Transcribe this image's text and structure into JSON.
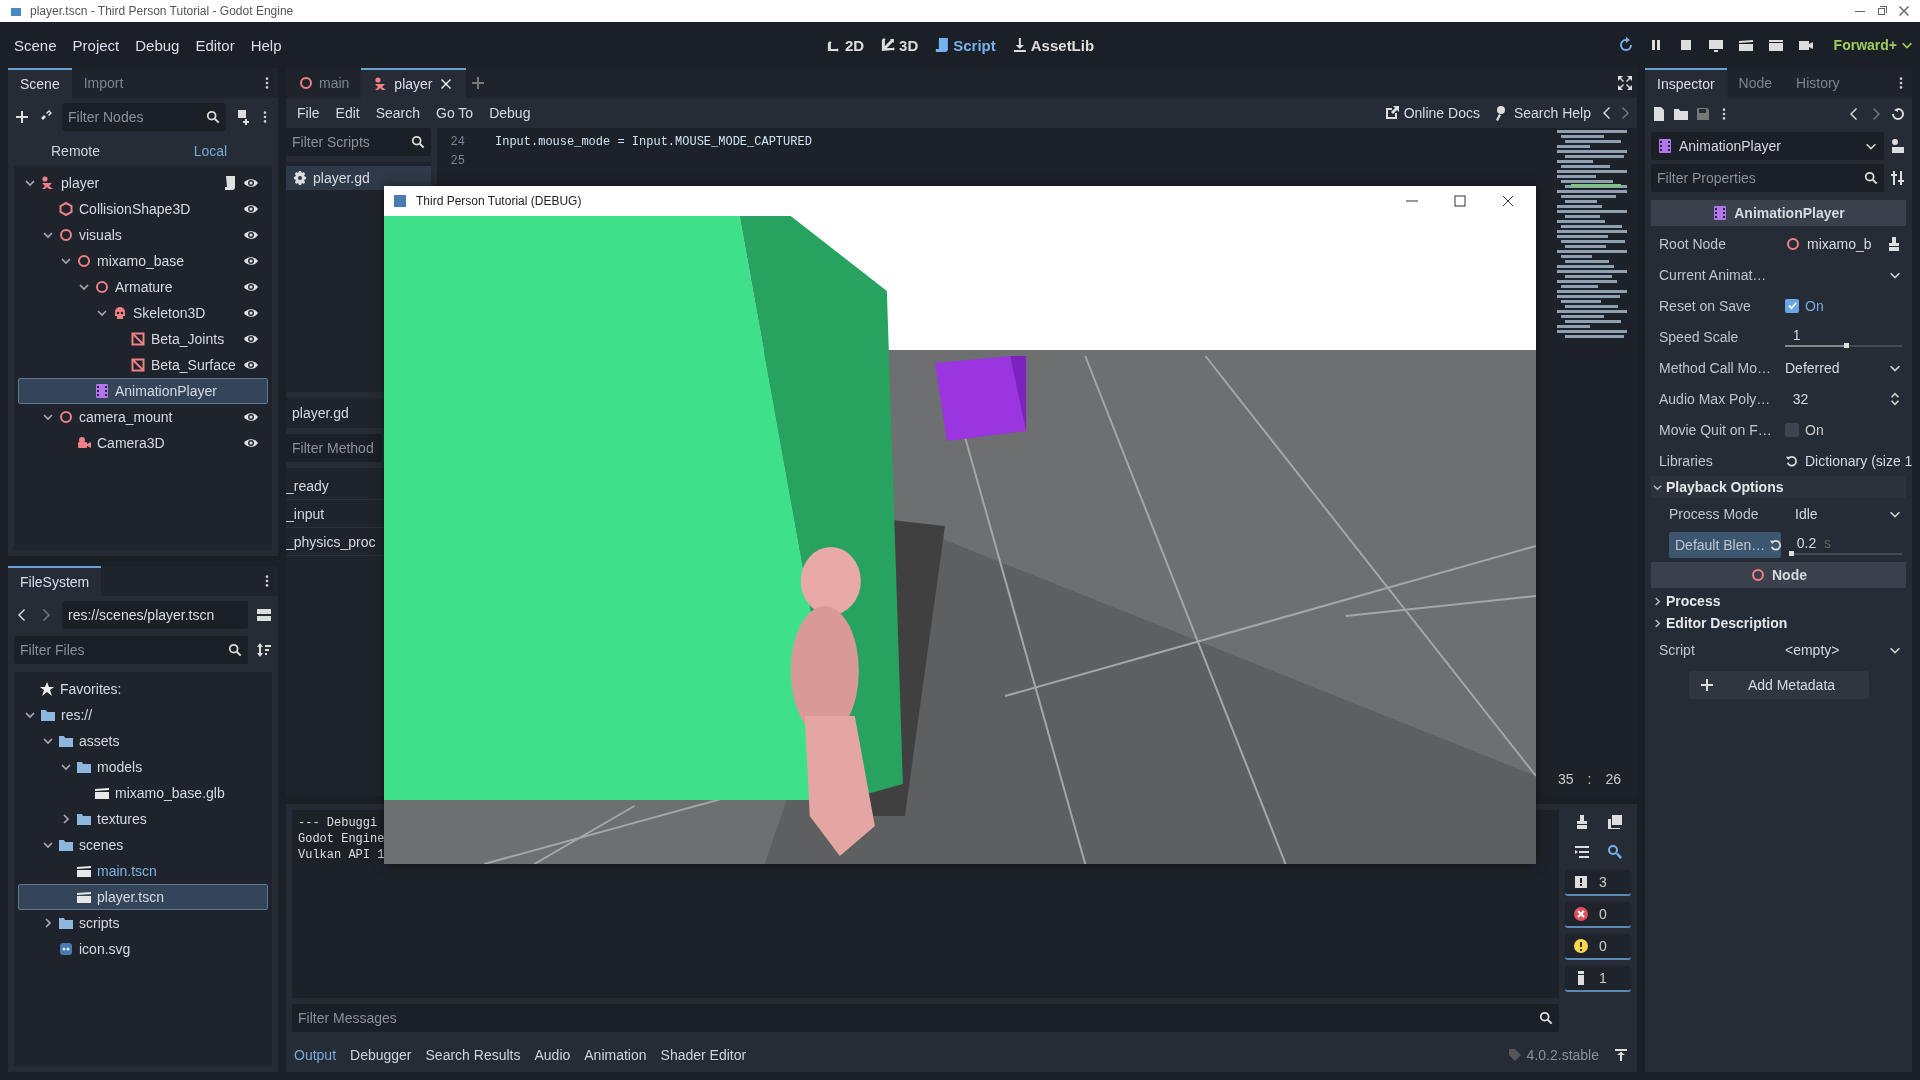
{
  "window": {
    "title": "player.tscn - Third Person Tutorial - Godot Engine"
  },
  "menu": [
    "Scene",
    "Project",
    "Debug",
    "Editor",
    "Help"
  ],
  "workspaces": [
    {
      "label": "2D",
      "kind": "flat",
      "selected": false
    },
    {
      "label": "3D",
      "kind": "spatial",
      "selected": false
    },
    {
      "label": "Script",
      "kind": "script",
      "selected": true
    },
    {
      "label": "AssetLib",
      "kind": "assetlib",
      "selected": false
    }
  ],
  "renderer": "Forward+",
  "scene_dock": {
    "tabs": [
      {
        "label": "Scene",
        "selected": true
      },
      {
        "label": "Import",
        "selected": false
      }
    ],
    "filter_placeholder": "Filter Nodes",
    "modes": [
      {
        "label": "Remote",
        "selected": false
      },
      {
        "label": "Local",
        "selected": true
      }
    ],
    "tree": [
      {
        "name": "player",
        "kind": "character",
        "script": true,
        "selected": false,
        "expanded": true,
        "children": [
          {
            "name": "CollisionShape3D",
            "kind": "collision",
            "selected": false
          },
          {
            "name": "visuals",
            "kind": "node3d",
            "selected": false,
            "expanded": true,
            "children": [
              {
                "name": "mixamo_base",
                "kind": "node3d",
                "selected": false,
                "expanded": true,
                "children": [
                  {
                    "name": "Armature",
                    "kind": "node3d",
                    "selected": false,
                    "expanded": true,
                    "children": [
                      {
                        "name": "Skeleton3D",
                        "kind": "skeleton",
                        "selected": false,
                        "expanded": true,
                        "children": [
                          {
                            "name": "Beta_Joints",
                            "kind": "mesh",
                            "selected": false
                          },
                          {
                            "name": "Beta_Surface",
                            "kind": "mesh",
                            "selected": false
                          }
                        ]
                      }
                    ]
                  },
                  {
                    "name": "AnimationPlayer",
                    "kind": "animation",
                    "selected": true
                  }
                ]
              }
            ]
          },
          {
            "name": "camera_mount",
            "kind": "node3d",
            "selected": false,
            "expanded": true,
            "children": [
              {
                "name": "Camera3D",
                "kind": "camera",
                "selected": false
              }
            ]
          }
        ]
      }
    ]
  },
  "filesystem": {
    "title": "FileSystem",
    "path": "res://scenes/player.tscn",
    "filter_placeholder": "Filter Files",
    "favorites": "Favorites:",
    "tree": [
      {
        "name": "res://",
        "kind": "folder",
        "selected": false,
        "expanded": true,
        "children": [
          {
            "name": "assets",
            "kind": "folder",
            "selected": false,
            "expanded": true,
            "children": [
              {
                "name": "models",
                "kind": "folder",
                "selected": false,
                "expanded": true,
                "children": [
                  {
                    "name": "mixamo_base.glb",
                    "kind": "scene",
                    "selected": false
                  }
                ]
              },
              {
                "name": "textures",
                "kind": "folder",
                "selected": false,
                "expanded": false
              }
            ]
          },
          {
            "name": "scenes",
            "kind": "folder",
            "selected": false,
            "expanded": true,
            "children": [
              {
                "name": "main.tscn",
                "kind": "scene",
                "main_scene": true,
                "selected": false
              },
              {
                "name": "player.tscn",
                "kind": "scene",
                "main_scene": false,
                "selected": true
              }
            ]
          },
          {
            "name": "scripts",
            "kind": "folder",
            "selected": false,
            "expanded": false
          },
          {
            "name": "icon.svg",
            "selected": false
          }
        ]
      }
    ]
  },
  "editor": {
    "tabs": [
      {
        "label": "main",
        "kind": "node3d",
        "selected": false
      },
      {
        "label": "player",
        "kind": "character",
        "selected": true
      }
    ],
    "menu": [
      "File",
      "Edit",
      "Search",
      "Go To",
      "Debug"
    ],
    "online_docs": "Online Docs",
    "search_help": "Search Help",
    "scripts_filter": "Filter Scripts",
    "scripts": [
      {
        "name": "player.gd",
        "selected": true
      }
    ],
    "current_script": "player.gd",
    "methods_filter": "Filter Method",
    "methods": [
      "_ready",
      "_input",
      "_physics_proc"
    ],
    "lines": [
      {
        "number": "24",
        "text": "Input.mouse_mode = Input.MOUSE_MODE_CAPTURED"
      },
      {
        "number": "25"
      }
    ],
    "cursor_line": "35",
    "cursor_separator": ":",
    "cursor_column": "26"
  },
  "output": {
    "lines": [
      "--- Debuggi",
      "Godot Engine",
      "Vulkan API 1"
    ],
    "filter_placeholder": "Filter Messages",
    "counters": [
      {
        "kind": "messages",
        "count": "3"
      },
      {
        "kind": "errors",
        "count": "0"
      },
      {
        "kind": "warnings",
        "count": "0"
      },
      {
        "kind": "info",
        "count": "1"
      }
    ],
    "tabs": [
      {
        "label": "Output",
        "selected": true
      },
      {
        "label": "Debugger",
        "selected": false
      },
      {
        "label": "Search Results",
        "selected": false
      },
      {
        "label": "Audio",
        "selected": false
      },
      {
        "label": "Animation",
        "selected": false
      },
      {
        "label": "Shader Editor",
        "selected": false
      }
    ],
    "version": "4.0.2.stable"
  },
  "inspector": {
    "tabs": [
      {
        "label": "Inspector",
        "selected": true
      },
      {
        "label": "Node",
        "selected": false
      },
      {
        "label": "History",
        "selected": false
      }
    ],
    "object": "AnimationPlayer",
    "filter_placeholder": "Filter Properties",
    "properties": [
      {
        "kind": "animation_section",
        "label": "AnimationPlayer"
      },
      {
        "kind": "node",
        "label": "Root Node",
        "value": "mixamo_b"
      },
      {
        "kind": "dropdown",
        "label": "Current Animat…"
      },
      {
        "kind": "check",
        "label": "Reset on Save",
        "checked": true,
        "value": "On"
      },
      {
        "kind": "slider",
        "label": "Speed Scale",
        "value": "1",
        "level": 0.52
      },
      {
        "kind": "dropdown",
        "label": "Method Call Mo…",
        "value": "Deferred"
      },
      {
        "kind": "spin",
        "label": "Audio Max Poly…",
        "value": "32"
      },
      {
        "kind": "check",
        "label": "Movie Quit on F…",
        "checked": false,
        "value": "On"
      },
      {
        "kind": "resource",
        "label": "Libraries",
        "value": "Dictionary (size 1"
      },
      {
        "kind": "group",
        "label": "Playback Options",
        "expanded": true,
        "children": [
          {
            "kind": "dropdown",
            "label": "Process Mode",
            "value": "Idle"
          },
          {
            "kind": "slider",
            "label": "Default Blen…",
            "value": "0.2",
            "suffix": "s",
            "level": 0.02,
            "modified": true
          }
        ]
      },
      {
        "kind": "node_section",
        "label": "Node"
      },
      {
        "kind": "group",
        "label": "Process",
        "expanded": false
      },
      {
        "kind": "group",
        "label": "Editor Description",
        "expanded": false
      },
      {
        "kind": "dropdown",
        "label": "Script",
        "value": "<empty>"
      }
    ],
    "add_button": "Add Metadata"
  },
  "game_window": {
    "title": "Third Person Tutorial (DEBUG)"
  }
}
